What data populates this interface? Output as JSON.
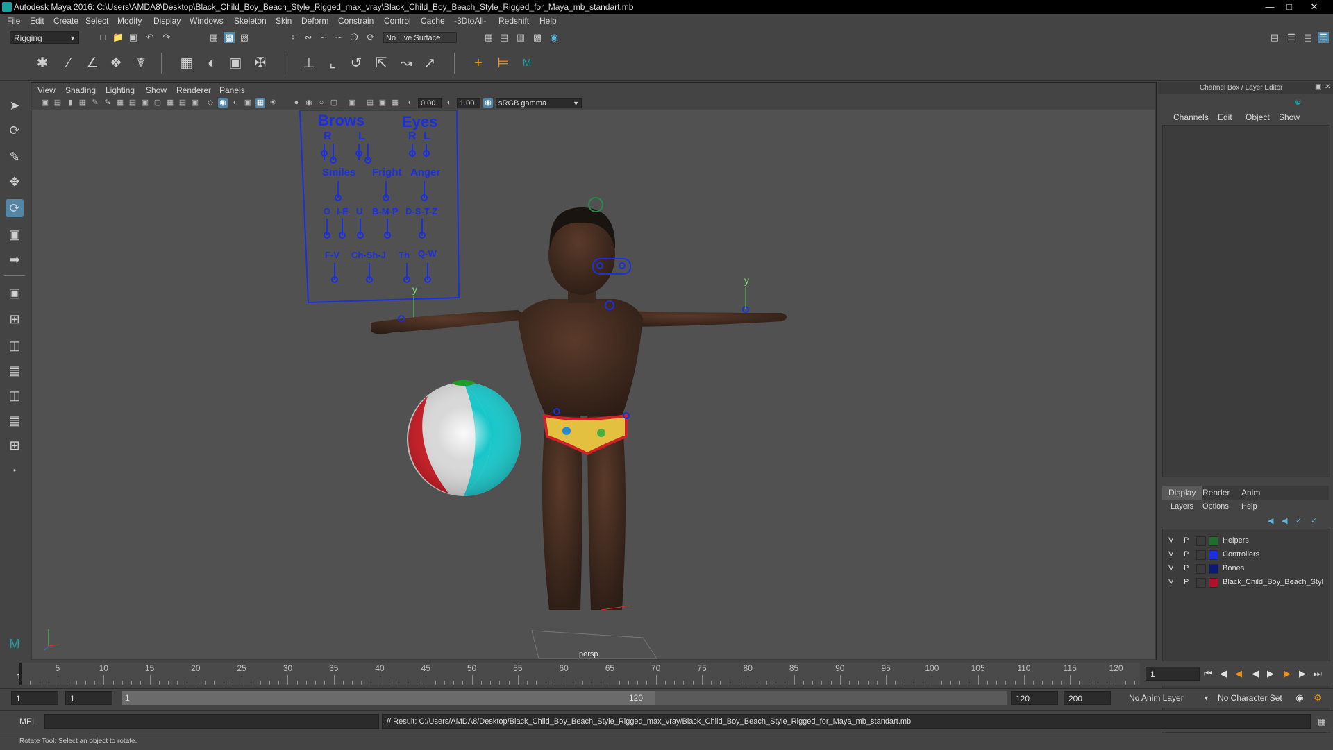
{
  "window": {
    "title": "Autodesk Maya 2016: C:\\Users\\AMDA8\\Desktop\\Black_Child_Boy_Beach_Style_Rigged_max_vray\\Black_Child_Boy_Beach_Style_Rigged_for_Maya_mb_standart.mb",
    "minimize": "—",
    "maximize": "□",
    "close": "✕"
  },
  "menubar": [
    "File",
    "Edit",
    "Create",
    "Select",
    "Modify",
    "Display",
    "Windows",
    "Skeleton",
    "Skin",
    "Deform",
    "Constrain",
    "Control",
    "Cache",
    "-3DtoAll-",
    "Redshift",
    "Help"
  ],
  "statusline": {
    "mode": "Rigging",
    "live_surface": "No Live Surface"
  },
  "viewport": {
    "menu": [
      "View",
      "Shading",
      "Lighting",
      "Show",
      "Renderer",
      "Panels"
    ],
    "exposure": "0.00",
    "gamma": "1.00",
    "color_space": "sRGB gamma",
    "camera_label": "persp",
    "axis_y": "y"
  },
  "face_gui": {
    "brows": "Brows",
    "eyes": "Eyes",
    "r": "R",
    "l": "L",
    "smiles": "Smiles",
    "fright": "Fright",
    "anger": "Anger",
    "o": "O",
    "ie": "I-E",
    "u": "U",
    "bmp": "B-M-P",
    "dstz": "D-S-T-Z",
    "fv": "F-V",
    "chshj": "Ch-Sh-J",
    "th": "Th",
    "qw": "Q-W"
  },
  "right_panel": {
    "title": "Channel Box / Layer Editor",
    "channel_menu": [
      "Channels",
      "Edit",
      "Object",
      "Show"
    ],
    "tabs": [
      "Display",
      "Render",
      "Anim"
    ],
    "layer_menu": [
      "Layers",
      "Options",
      "Help"
    ],
    "layers": [
      {
        "v": "V",
        "p": "P",
        "name": "Helpers",
        "color": "#1e6e2e"
      },
      {
        "v": "V",
        "p": "P",
        "name": "Controllers",
        "color": "#1a2fe0"
      },
      {
        "v": "V",
        "p": "P",
        "name": "Bones",
        "color": "#0a1a7a"
      },
      {
        "v": "V",
        "p": "P",
        "name": "Black_Child_Boy_Beach_Styl",
        "color": "#b0102a"
      }
    ]
  },
  "timeline": {
    "ticks": [
      "1",
      "5",
      "10",
      "15",
      "20",
      "25",
      "30",
      "35",
      "40",
      "45",
      "50",
      "55",
      "60",
      "65",
      "70",
      "75",
      "80",
      "85",
      "90",
      "95",
      "100",
      "105",
      "110",
      "115",
      "120"
    ],
    "current_frame": "1"
  },
  "range": {
    "start": "1",
    "playback_start": "1",
    "range_start_label": "1",
    "range_end_label": "120",
    "playback_end": "120",
    "end": "200",
    "anim_layer": "No Anim Layer",
    "char_set": "No Character Set"
  },
  "command": {
    "lang": "MEL",
    "result": "// Result: C:/Users/AMDA8/Desktop/Black_Child_Boy_Beach_Style_Rigged_max_vray/Black_Child_Boy_Beach_Style_Rigged_for_Maya_mb_standart.mb"
  },
  "help_line": "Rotate Tool: Select an object to rotate.",
  "colors": {
    "accent": "#5285a6",
    "controller_blue": "#1a2fe0",
    "skin": "#3c2a20"
  }
}
